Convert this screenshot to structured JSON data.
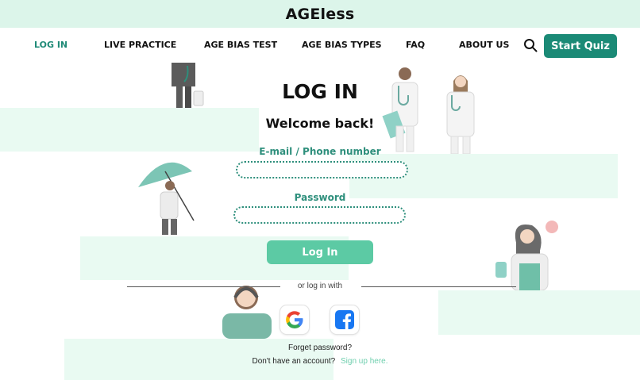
{
  "brand": {
    "name": "AGEless"
  },
  "nav": {
    "items": [
      {
        "label": "LOG IN",
        "active": true
      },
      {
        "label": "LIVE PRACTICE",
        "active": false
      },
      {
        "label": "AGE BIAS TEST",
        "active": false
      },
      {
        "label": "AGE BIAS TYPES",
        "active": false
      },
      {
        "label": "FAQ",
        "active": false
      },
      {
        "label": "ABOUT US",
        "active": false
      }
    ],
    "search_icon": "search-icon",
    "cta_label": "Start Quiz"
  },
  "login": {
    "title": "LOG IN",
    "welcome": "Welcome back!",
    "email_label": "E-mail / Phone number",
    "email_value": "",
    "password_label": "Password",
    "password_value": "",
    "submit_label": "Log In",
    "alt_text": "or log in with",
    "social": [
      "google-icon",
      "facebook-icon"
    ],
    "forgot_label": "Forget password?",
    "signup_prompt": "Don't have an account?",
    "signup_link": "Sign up here."
  },
  "colors": {
    "accent": "#1b8a76",
    "accent_light": "#5ccaa4",
    "label_green": "#2e8f7c",
    "band": "#e9faf2",
    "topbar": "#dcf5ea"
  }
}
